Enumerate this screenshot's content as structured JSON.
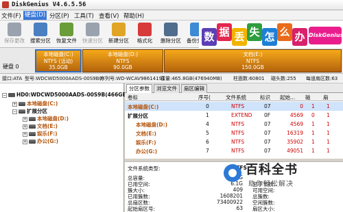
{
  "window": {
    "title": "DiskGenius V4.6.5.56"
  },
  "menu": [
    "文件(F)",
    "硬盘(D)",
    "分区(P)",
    "工具(T)",
    "查看(V)",
    "帮助(H)"
  ],
  "toolbar": [
    {
      "label": "保存更改",
      "icon": "save-icon",
      "color": "#9aa3ad",
      "disabled": true
    },
    {
      "label": "搜索分区",
      "icon": "search-partition-icon",
      "color": "#4a7fc1",
      "disabled": false
    },
    {
      "label": "恢复文件",
      "icon": "recover-files-icon",
      "color": "#6a9c3a",
      "disabled": false
    },
    {
      "label": "快速分区",
      "icon": "quick-partition-icon",
      "color": "#9aa3ad",
      "disabled": true
    },
    {
      "label": "新建分区",
      "icon": "new-partition-icon",
      "color": "#e0a526",
      "disabled": false
    },
    {
      "label": "格式化",
      "icon": "format-icon",
      "color": "#d63a3a",
      "disabled": false
    },
    {
      "label": "删除分区",
      "icon": "delete-partition-icon",
      "color": "#4f6d8c",
      "disabled": false
    },
    {
      "label": "备份分区",
      "icon": "backup-partition-icon",
      "color": "#3d8ad6",
      "disabled": false
    }
  ],
  "banner": {
    "chars": [
      {
        "ch": "数",
        "color": "#5b3fb5"
      },
      {
        "ch": "据",
        "color": "#e2264e"
      },
      {
        "ch": "丢",
        "color": "#f2b400"
      },
      {
        "ch": "失",
        "color": "#2e9d3e"
      },
      {
        "ch": "怎",
        "color": "#1e7fd6"
      },
      {
        "ch": "么",
        "color": "#ea6b1a"
      },
      {
        "ch": "办",
        "color": "#d8206b"
      }
    ],
    "brand": "DiskGenius"
  },
  "diskmap": {
    "label": "硬盘 0",
    "segments": [
      {
        "name": "本地磁盘(C:)",
        "fs": "NTFS (活动)",
        "size": "35.0GB"
      },
      {
        "name": "本地磁盘(D:)",
        "fs": "NTFS",
        "size": "90.0GB"
      },
      {
        "name": "文档(E:)",
        "fs": "NTFS",
        "size": "150.0GB"
      }
    ]
  },
  "infobar": [
    "接口:ATA",
    "型号:WDCWD5000AADS-00S9B0",
    "序列号:WD-WCAV98614191",
    "容量:465.8GB(476940MB)",
    "柱面数:60801",
    "磁头数:255",
    "每道扇区数:63"
  ],
  "tree": {
    "disk": "HD0:WDCWD5000AADS-00S9B(466GB)",
    "nodes": [
      {
        "label": "本地磁盘(C:)",
        "level": 1,
        "type": "part"
      },
      {
        "label": "扩展分区",
        "level": 1,
        "type": "ext"
      },
      {
        "label": "本地磁盘(D:)",
        "level": 2,
        "type": "part"
      },
      {
        "label": "文档(E:)",
        "level": 2,
        "type": "part"
      },
      {
        "label": "娱乐(F:)",
        "level": 2,
        "type": "part"
      },
      {
        "label": "办公(G:)",
        "level": 2,
        "type": "part"
      }
    ]
  },
  "tabs": [
    "分区参数",
    "浏览文件",
    "扇区编辑"
  ],
  "table": {
    "headers": [
      "卷标",
      "序号(",
      "文件系统",
      "标识",
      "起始...",
      "磁",
      "扇"
    ],
    "rows": [
      {
        "name": "本地磁盘(C:)",
        "idx": "0",
        "fs": "NTFS",
        "id": "07",
        "start": "0",
        "h": "1",
        "s": "1",
        "sel": true,
        "indent": 0
      },
      {
        "name": "扩展分区",
        "idx": "1",
        "fs": "EXTEND",
        "id": "0F",
        "start": "4569",
        "h": "0",
        "s": "1",
        "sel": false,
        "indent": 0
      },
      {
        "name": "本地磁盘(D:)",
        "idx": "4",
        "fs": "NTFS",
        "id": "07",
        "start": "4569",
        "h": "1",
        "s": "1",
        "sel": false,
        "indent": 1
      },
      {
        "name": "文档(E:)",
        "idx": "5",
        "fs": "NTFS",
        "id": "07",
        "start": "16319",
        "h": "1",
        "s": "1",
        "sel": false,
        "indent": 1
      },
      {
        "name": "娱乐(F:)",
        "idx": "6",
        "fs": "NTFS",
        "id": "07",
        "start": "35902",
        "h": "1",
        "s": "1",
        "sel": false,
        "indent": 1
      },
      {
        "name": "办公(G:)",
        "idx": "7",
        "fs": "NTFS",
        "id": "07",
        "start": "49051",
        "h": "1",
        "s": "1",
        "sel": false,
        "indent": 1
      }
    ]
  },
  "details": {
    "fs_label": "文件系统类型:",
    "fs_value": "NTFS",
    "left": [
      {
        "k": "总容量:",
        "v": "35.0G"
      },
      {
        "k": "已用空间:",
        "v": "6.1G"
      },
      {
        "k": "簇大小:",
        "v": "409"
      },
      {
        "k": "已用簇数:",
        "v": "1608201"
      },
      {
        "k": "总扇区数:",
        "v": "73400922"
      },
      {
        "k": "起始扇区号:",
        "v": "63"
      }
    ],
    "right": [
      {
        "k": "总字节数:",
        "v": ""
      },
      {
        "k": "可用空间:",
        "v": ""
      },
      {
        "k": "总簇数:",
        "v": ""
      },
      {
        "k": "空闲簇数:",
        "v": ""
      },
      {
        "k": "扇区大小:",
        "v": ""
      }
    ]
  },
  "watermark": {
    "big": "百科全书",
    "sub": "助你轻松解决"
  }
}
